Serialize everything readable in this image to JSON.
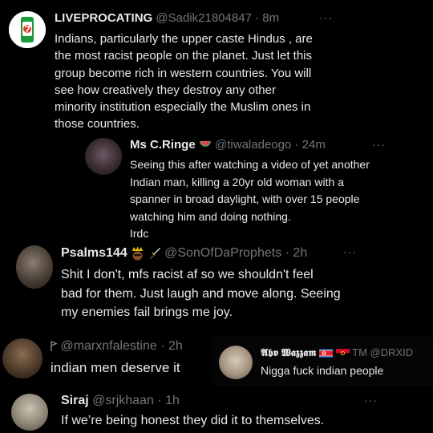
{
  "colors": {
    "background": "#000000",
    "text_primary": "#e7e9ea",
    "text_secondary": "#71767b"
  },
  "tweets": [
    {
      "display_name": "LIVEPROCATING",
      "handle": "@Sadik21804847",
      "separator": "·",
      "time": "8m",
      "more": "···",
      "avatar_icon": "7up-logo-avatar",
      "text_lines": [
        "Indians, particularly the upper caste Hindus , are",
        "the most racist people on the planet. Just let this",
        "group become rich in western countries. You will",
        "see how creatively they destroy any other",
        "minority institution especially the Muslim ones in",
        "those countries."
      ]
    },
    {
      "display_name": "Ms C.Ringe",
      "name_emoji": "watermelon-icon",
      "handle": "@tiwaladeogo",
      "separator": "·",
      "time": "24m",
      "more": "···",
      "text_lines": [
        "Seeing this after watching a video of yet another",
        "Indian man, killing a 20yr old woman with a",
        "spanner in broad daylight, with over 15 people",
        "watching him and doing nothing.",
        "Irdc"
      ]
    },
    {
      "display_name": "Psalms144",
      "name_emoji": [
        "crowned-face-icon",
        "dagger-icon"
      ],
      "handle": "@SonOfDaProphets",
      "separator": "·",
      "time": "2h",
      "more": "···",
      "text_lines": [
        "Shit I don't, mfs racist af so we shouldn't feel",
        "bad for them. Just laugh and move along. Seeing",
        "my enemies fail brings me joy."
      ]
    },
    {
      "handle": "@marxnfalestine",
      "separator": "·",
      "time": "2h",
      "text_lines": [
        "indian men deserve it"
      ]
    },
    {
      "display_name": "𝕬𝖇𝖛 𝖂𝖆𝖟𝖟𝖆𝖒",
      "name_flags": [
        "north-korea-flag-icon",
        "angola-flag-icon"
      ],
      "tm": "TM",
      "handle": "@DRXID",
      "text_lines": [
        "Nigga fuck indian people"
      ]
    },
    {
      "display_name": "Siraj",
      "handle": "@srjkhaan",
      "separator": "·",
      "time": "1h",
      "more": "···",
      "text_lines": [
        "If we’re being honest they did it to themselves."
      ]
    }
  ]
}
